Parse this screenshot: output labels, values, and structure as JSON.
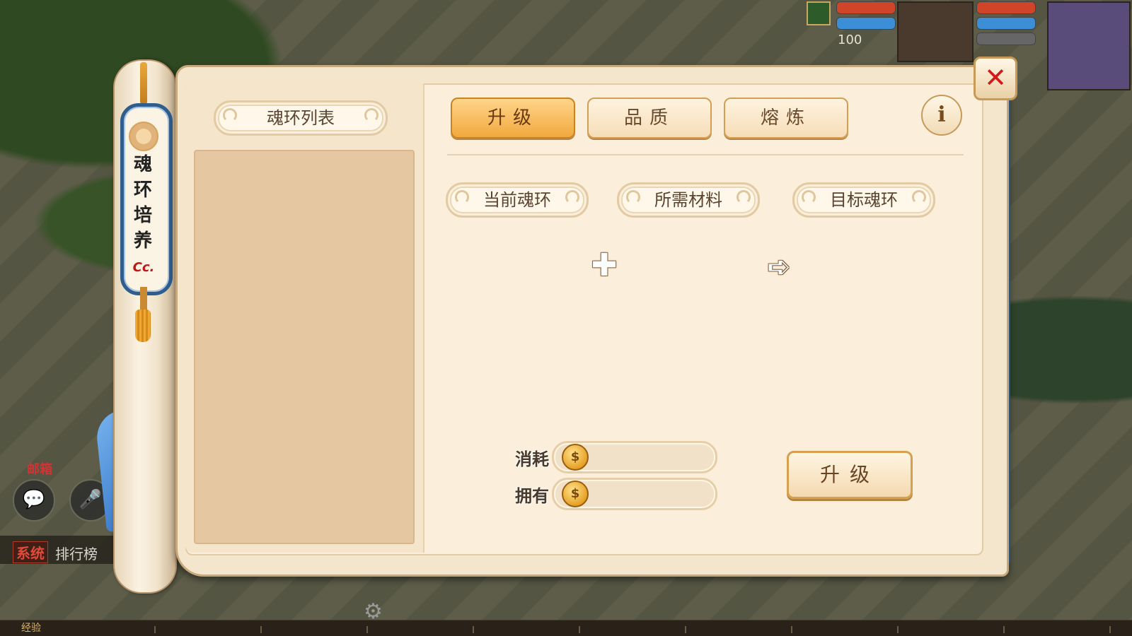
{
  "window": {
    "title": "魂环培养",
    "title_chars": [
      "魂",
      "环",
      "培",
      "养"
    ],
    "title_mark": "Cc."
  },
  "left_panel": {
    "header": "魂环列表"
  },
  "tabs": [
    {
      "label": "升级",
      "active": true
    },
    {
      "label": "品质",
      "active": false
    },
    {
      "label": "熔炼",
      "active": false
    }
  ],
  "info_icon": "i",
  "sections": {
    "current": "当前魂环",
    "materials": "所需材料",
    "target": "目标魂环"
  },
  "symbols": {
    "plus": "✚",
    "arrow": "➪"
  },
  "cost": {
    "consume_label": "消耗",
    "own_label": "拥有",
    "consume_value": "",
    "own_value": ""
  },
  "upgrade_button": "升级",
  "close_icon": "✕",
  "hud": {
    "level": "100"
  },
  "chat": {
    "system_tag": "系统",
    "message": "排行榜"
  },
  "mailbox_label": "邮箱",
  "exp_label": "经验",
  "colors": {
    "tab_active": "#f1a93e",
    "close_red": "#d11a1a",
    "frame_blue": "#2f5d8e"
  }
}
